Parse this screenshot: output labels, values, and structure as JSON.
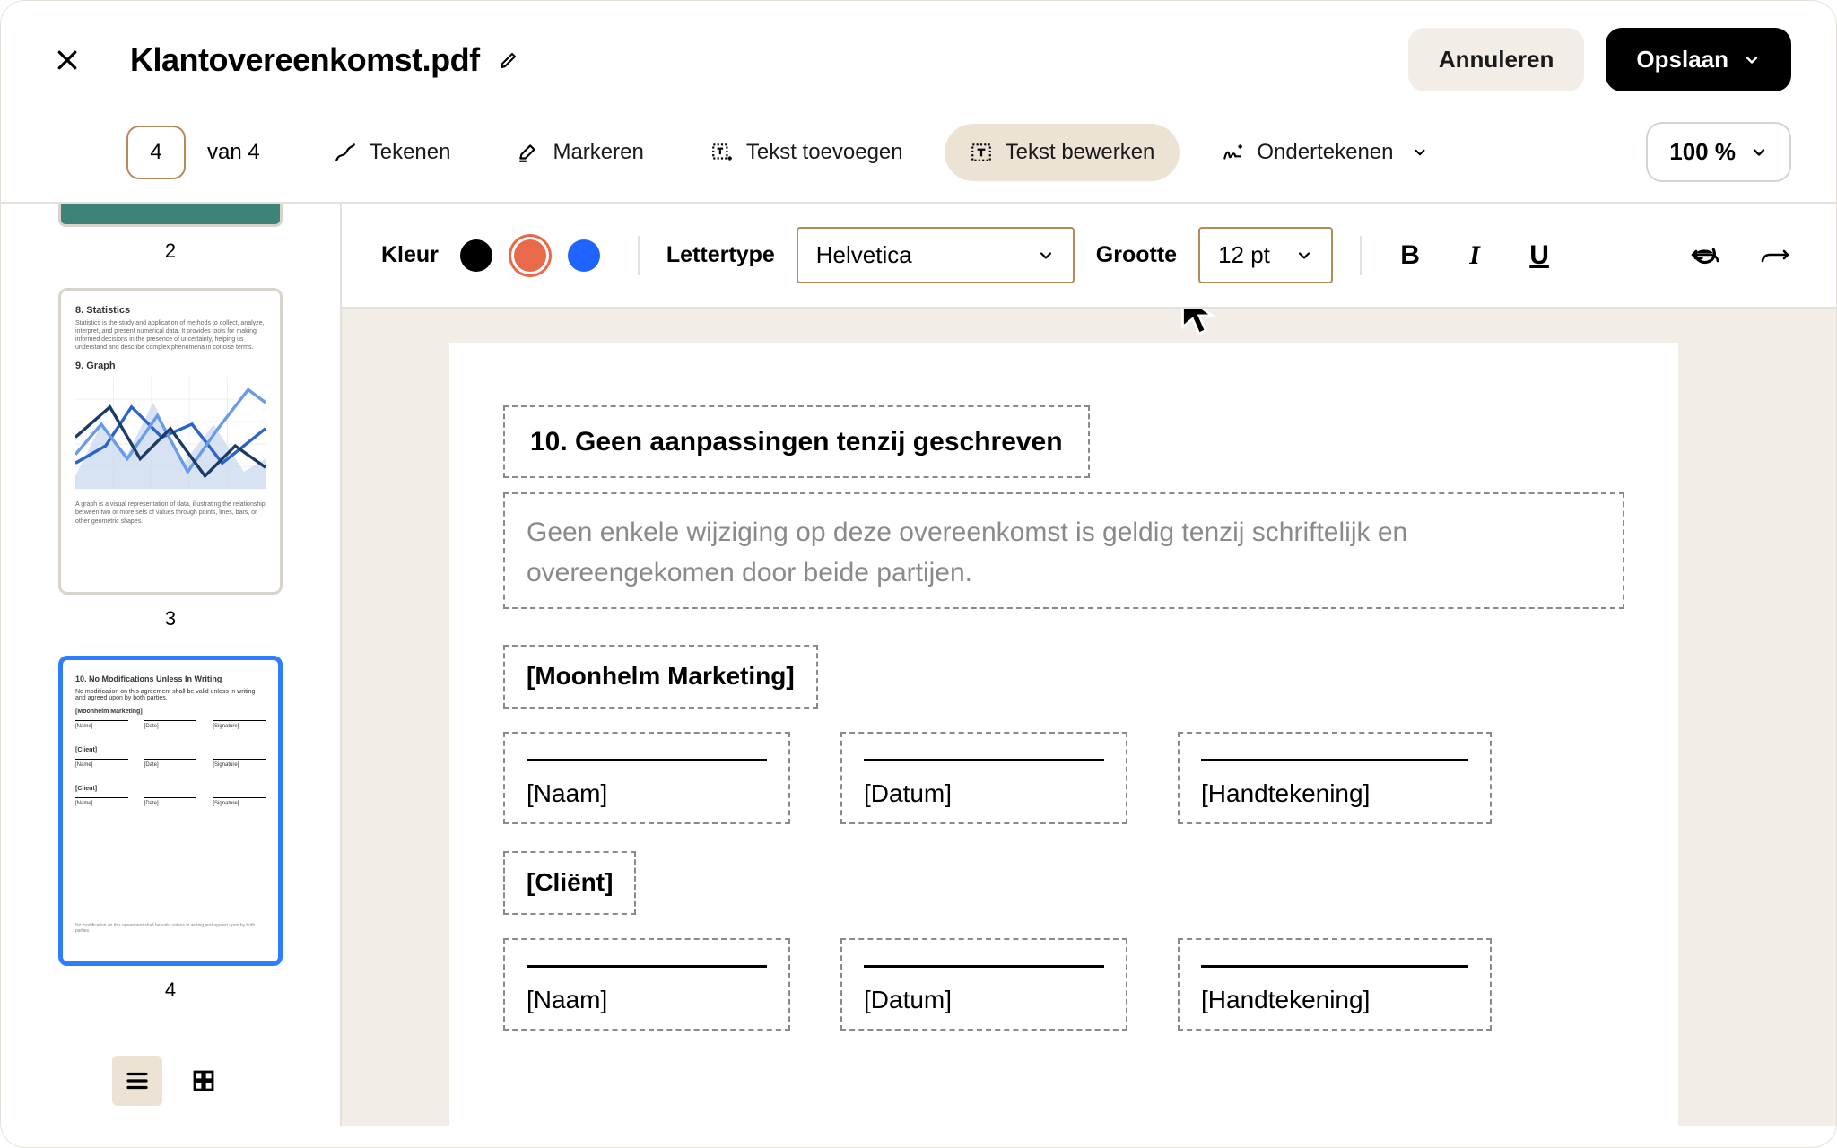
{
  "header": {
    "filename": "Klantovereenkomst.pdf",
    "cancel_label": "Annuleren",
    "save_label": "Opslaan"
  },
  "pager": {
    "current": "4",
    "total_label": "van 4"
  },
  "tools": {
    "draw": "Tekenen",
    "highlight": "Markeren",
    "add_text": "Tekst toevoegen",
    "edit_text": "Tekst bewerken",
    "sign": "Ondertekenen"
  },
  "zoom": {
    "label": "100 %"
  },
  "format": {
    "color_label": "Kleur",
    "font_label": "Lettertype",
    "font_value": "Helvetica",
    "size_label": "Grootte",
    "size_value": "12 pt",
    "colors": {
      "black": "#000000",
      "orange": "#e96a4a",
      "blue": "#1f64ff"
    }
  },
  "document": {
    "heading": "10. Geen aanpassingen tenzij geschreven",
    "body": "Geen enkele wijziging op deze overeenkomst is geldig tenzij schriftelijk en overeengekomen door beide partijen.",
    "party1": "[Moonhelm Marketing]",
    "party2": "[Cliënt]",
    "field_name": "[Naam]",
    "field_date": "[Datum]",
    "field_signature": "[Handtekening]"
  },
  "thumbs": {
    "p2": "2",
    "p3": "3",
    "p4": "4",
    "p3_content": {
      "h1": "8. Statistics",
      "p1": "Statistics is the study and application of methods to collect, analyze, interpret, and present numerical data. It provides tools for making informed decisions in the presence of uncertainty, helping us understand and describe complex phenomena in concise terms.",
      "h2": "9. Graph",
      "p2": "A graph is a visual representation of data, illustrating the relationship between two or more sets of values through points, lines, bars, or other geometric shapes."
    },
    "p4_content": {
      "h": "10. No Modifications Unless In Writing",
      "p": "No modification on this agreement shall be valid unless in writing and agreed upon by both parties.",
      "party1": "[Moonhelm Marketing]",
      "party2": "[Client]",
      "name": "[Name]",
      "date": "[Date]",
      "sig": "[Signature]",
      "foot": "No modification on this agreement shall be valid unless in writing and agreed upon by both parties."
    }
  }
}
